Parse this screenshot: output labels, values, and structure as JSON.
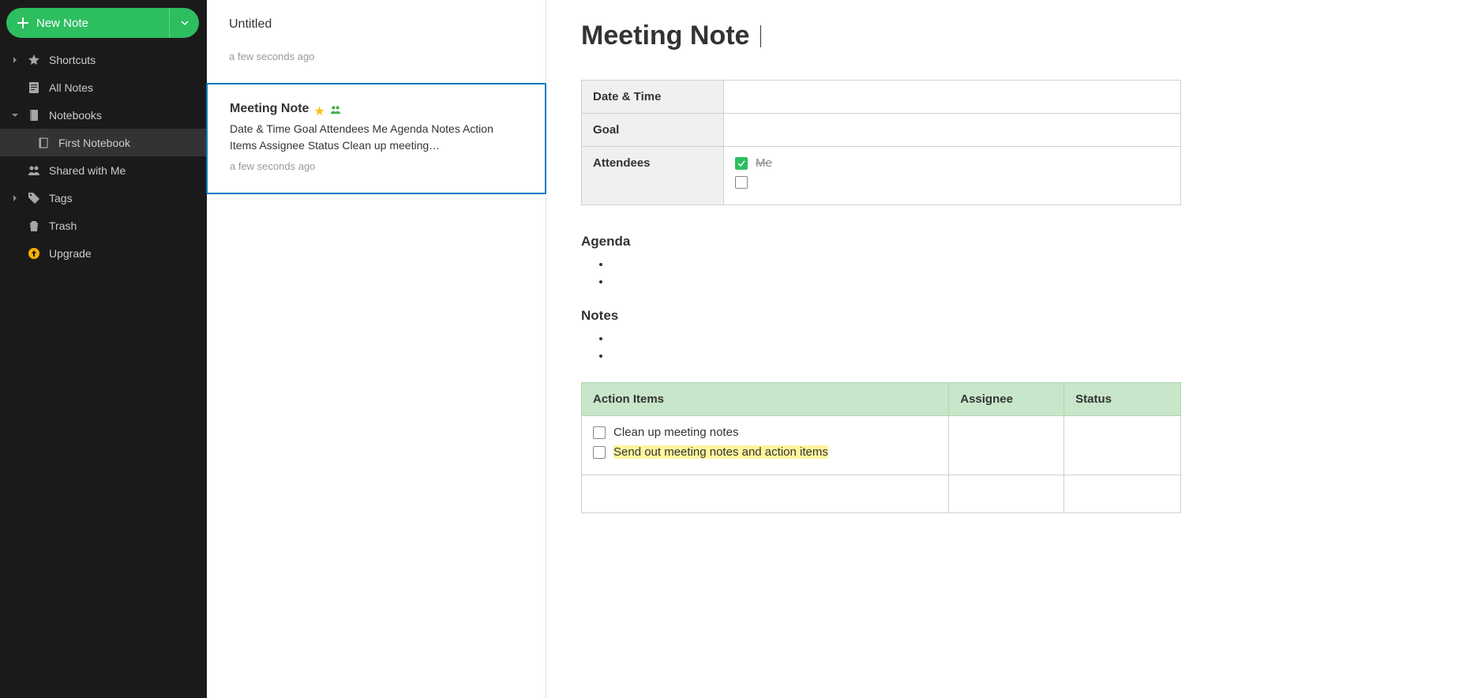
{
  "sidebar": {
    "new_note": "New Note",
    "items": [
      {
        "key": "shortcuts",
        "label": "Shortcuts",
        "expandable": true
      },
      {
        "key": "all-notes",
        "label": "All Notes",
        "expandable": false
      },
      {
        "key": "notebooks",
        "label": "Notebooks",
        "expandable": true,
        "expanded": true
      },
      {
        "key": "first-notebook",
        "label": "First Notebook",
        "sub": true
      },
      {
        "key": "shared",
        "label": "Shared with Me",
        "expandable": false
      },
      {
        "key": "tags",
        "label": "Tags",
        "expandable": true
      },
      {
        "key": "trash",
        "label": "Trash",
        "expandable": false
      },
      {
        "key": "upgrade",
        "label": "Upgrade",
        "expandable": false
      }
    ]
  },
  "notelist": {
    "notes": [
      {
        "title": "Untitled",
        "preview": "",
        "time": "a few seconds ago",
        "selected": false,
        "starred": false,
        "shared": false
      },
      {
        "title": "Meeting Note",
        "preview": "Date & Time Goal Attendees Me Agenda Notes Action Items Assignee Status Clean up meeting…",
        "time": "a few seconds ago",
        "selected": true,
        "starred": true,
        "shared": true
      }
    ]
  },
  "editor": {
    "title": "Meeting Note",
    "meta": {
      "rows": [
        {
          "label": "Date & Time",
          "value": ""
        },
        {
          "label": "Goal",
          "value": ""
        },
        {
          "label": "Attendees",
          "attendees": [
            {
              "name": "Me",
              "checked": true
            },
            {
              "name": "",
              "checked": false
            }
          ]
        }
      ]
    },
    "sections": {
      "agenda": {
        "heading": "Agenda",
        "bullets": [
          "",
          ""
        ]
      },
      "notes": {
        "heading": "Notes",
        "bullets": [
          "",
          ""
        ]
      }
    },
    "action_table": {
      "headers": [
        "Action Items",
        "Assignee",
        "Status"
      ],
      "rows": [
        {
          "items": [
            {
              "label": "Clean up meeting notes",
              "checked": false,
              "highlight": false
            },
            {
              "label": "Send out meeting notes and action items",
              "checked": false,
              "highlight": true
            }
          ],
          "assignee": "",
          "status": ""
        },
        {
          "items": [],
          "assignee": "",
          "status": ""
        }
      ]
    }
  }
}
